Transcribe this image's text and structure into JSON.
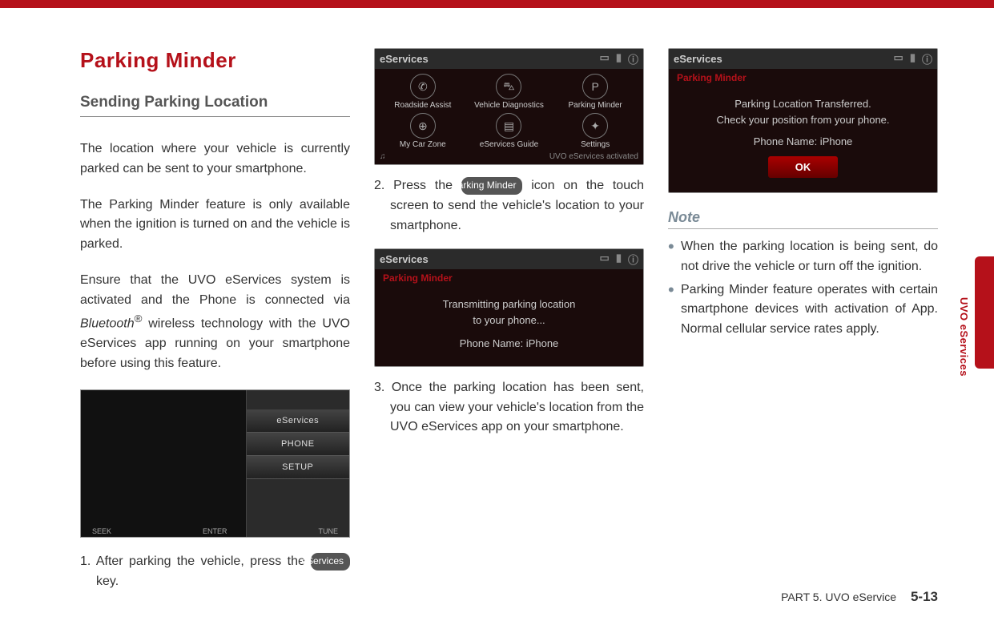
{
  "heading": "Parking Minder",
  "section": "Sending Parking Location",
  "col1": {
    "p1": "The location where your vehicle is currently parked can be sent to your smartphone.",
    "p2a": "The Parking Minder feature is only available when the ignition is turned on and the vehicle is parked.",
    "p2b_pre": "Ensure that the UVO eServices system is activated and the Phone is connected via ",
    "p2b_bt": "Bluetooth",
    "p2b_post": " wireless technology with the UVO eServices app running on your smartphone before using this feature.",
    "dash": {
      "btn1": "eServices",
      "btn2": "PHONE",
      "btn3": "SETUP",
      "seek": "SEEK",
      "enter": "ENTER",
      "tune": "TUNE"
    },
    "step1_pre": "1. After parking the vehicle, press the ",
    "step1_pill": "eServices",
    "step1_post": " key."
  },
  "col2": {
    "menu": {
      "title": "eServices",
      "items": [
        "Roadside Assist",
        "Vehicle Diagnostics",
        "Parking Minder",
        "My Car Zone",
        "eServices Guide",
        "Settings"
      ],
      "footer": "UVO eServices activated"
    },
    "step2_pre": "2. Press the ",
    "step2_pill": "Parking Minder",
    "step2_post": " icon on the touch screen to send the vehicle's location to your smartphone.",
    "transmit": {
      "title": "eServices",
      "sub": "Parking Minder",
      "line1": "Transmitting parking location",
      "line2": "to your phone...",
      "phone": "Phone Name: iPhone"
    },
    "step3": "3. Once the parking location has been sent, you can view your vehicle's location from the UVO eServices app on your smartphone."
  },
  "col3": {
    "confirm": {
      "title": "eServices",
      "sub": "Parking Minder",
      "line1": "Parking Location Transferred.",
      "line2": "Check your position from your phone.",
      "phone": "Phone Name: iPhone",
      "ok": "OK"
    },
    "note_heading": "Note",
    "note1": "When the parking location is being sent, do not drive the vehicle or turn off the ignition.",
    "note2": "Parking Minder feature operates with certain smartphone devices with activation of App. Normal cellular service rates apply."
  },
  "side_label": "UVO eServices",
  "footer_part": "PART 5. UVO eService",
  "footer_page": "5-13"
}
